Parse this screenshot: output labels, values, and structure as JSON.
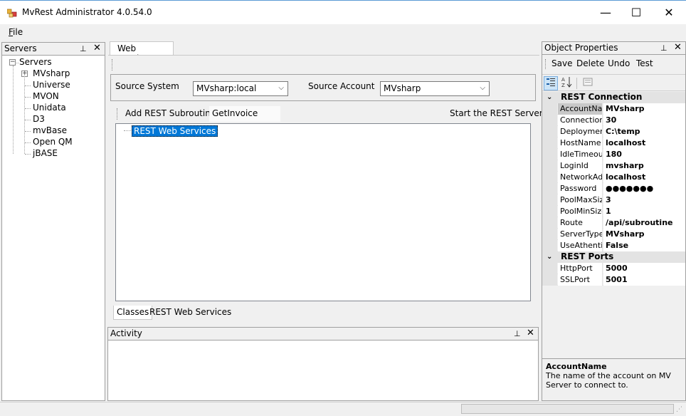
{
  "window": {
    "title": "MvRest Administrator 4.0.54.0",
    "minimize": "—",
    "maximize": "☐",
    "close": "✕"
  },
  "menu": {
    "file": "File"
  },
  "servers_panel": {
    "title": "Servers",
    "pin": "📌",
    "close": "✕",
    "root": "Servers",
    "items": [
      "MVsharp",
      "Universe",
      "MVON",
      "Unidata",
      "D3",
      "mvBase",
      "Open QM",
      "jBASE"
    ]
  },
  "document": {
    "tab": "Web Services",
    "source_system_label": "Source System",
    "source_system_value": "MVsharp:local",
    "source_account_label": "Source Account",
    "source_account_value": "MVsharp",
    "add_rest_subroutine": "Add REST Subroutine",
    "get_invoice": "GetInvoice",
    "start_server": "Start the REST Server",
    "tree_node": "REST Web Services",
    "bottom_tabs": [
      "Classes",
      "REST Web Services"
    ]
  },
  "activity_panel": {
    "title": "Activity",
    "pin": "📌",
    "close": "✕"
  },
  "properties_panel": {
    "title": "Object Properties",
    "pin": "📌",
    "close": "✕",
    "toolbar": {
      "save": "Save",
      "delete": "Delete",
      "undo": "Undo",
      "test": "Test"
    },
    "categories": [
      {
        "name": "REST Connection",
        "rows": [
          {
            "name": "AccountName",
            "value": "MVsharp"
          },
          {
            "name": "ConnectionTimeout",
            "value": "30"
          },
          {
            "name": "DeploymentPath",
            "value": "C:\\temp"
          },
          {
            "name": "HostName",
            "value": "localhost"
          },
          {
            "name": "IdleTimeout",
            "value": "180"
          },
          {
            "name": "LoginId",
            "value": "mvsharp"
          },
          {
            "name": "NetworkAdapter",
            "value": "localhost"
          },
          {
            "name": "Password",
            "value": "●●●●●●●"
          },
          {
            "name": "PoolMaxSize",
            "value": "3"
          },
          {
            "name": "PoolMinSize",
            "value": "1"
          },
          {
            "name": "Route",
            "value": "/api/subroutine"
          },
          {
            "name": "ServerType",
            "value": "MVsharp"
          },
          {
            "name": "UseAthentication",
            "value": "False"
          }
        ]
      },
      {
        "name": "REST Ports",
        "rows": [
          {
            "name": "HttpPort",
            "value": "5000"
          },
          {
            "name": "SSLPort",
            "value": "5001"
          }
        ]
      }
    ],
    "description_title": "AccountName",
    "description_text": "The name of the account on MV Server to connect to."
  }
}
